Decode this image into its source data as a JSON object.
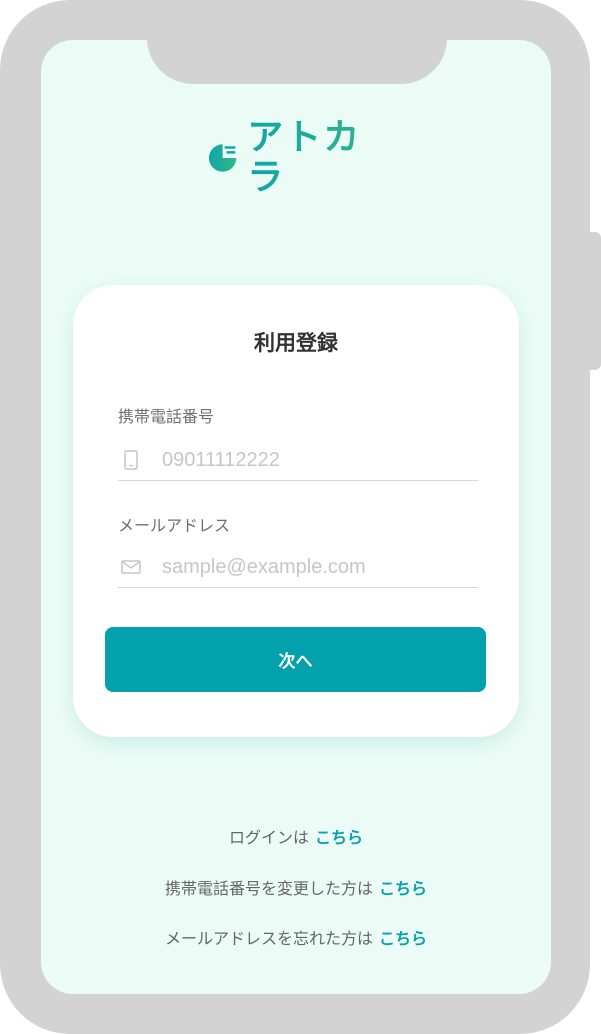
{
  "brand": {
    "name": "アトカラ",
    "logo_icon": "half-circle-logo-icon",
    "colors": {
      "accent": "#03a1ac",
      "logo_start": "#11a5a7",
      "logo_end": "#31b788",
      "screen_bg": "#ebfcf6"
    }
  },
  "form": {
    "title": "利用登録",
    "phone": {
      "label": "携帯電話番号",
      "placeholder": "09011112222",
      "value": "",
      "icon": "phone-icon"
    },
    "email": {
      "label": "メールアドレス",
      "placeholder": "sample@example.com",
      "value": "",
      "icon": "mail-icon"
    },
    "submit_label": "次へ"
  },
  "footer": {
    "login": {
      "text": "ログインは",
      "link": "こちら"
    },
    "phone_changed": {
      "text": "携帯電話番号を変更した方は",
      "link": "こちら"
    },
    "email_forgot": {
      "text": "メールアドレスを忘れた方は",
      "link": "こちら"
    }
  }
}
